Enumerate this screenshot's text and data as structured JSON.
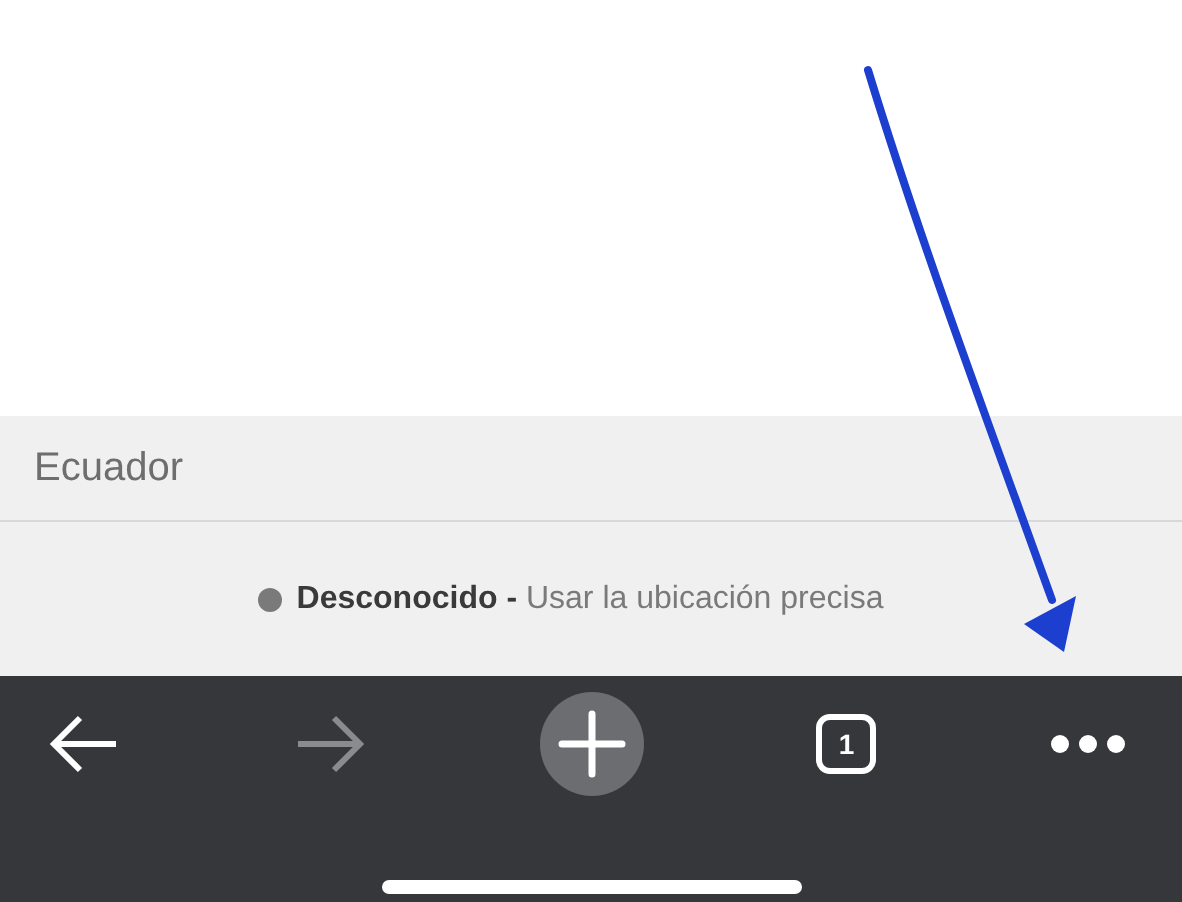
{
  "country_row": {
    "label": "Ecuador"
  },
  "location_status": {
    "text": "**Desconocido -** Usar la ubicación precisa"
  },
  "toolbar": [
    {
      "kind": "back",
      "disabled": false
    },
    {
      "kind": "forward",
      "disabled": true
    },
    {
      "kind": "new_tab",
      "disabled": false
    },
    {
      "kind": "tabs",
      "count": "1",
      "disabled": false
    },
    {
      "kind": "menu",
      "disabled": false
    }
  ]
}
